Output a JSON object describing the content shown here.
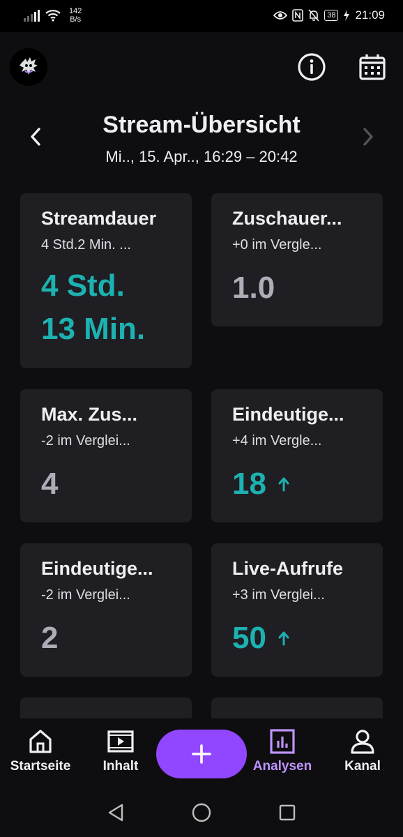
{
  "status_bar": {
    "net_speed_value": "142",
    "net_speed_unit": "B/s",
    "battery": "38",
    "time": "21:09"
  },
  "header": {
    "title": "Stream-Übersicht",
    "subtitle": "Mi.., 15. Apr.., 16:29 – 20:42"
  },
  "cards": [
    {
      "title": "Streamdauer",
      "sub": "4 Std.2 Min. ...",
      "value_line1": "4 Std.",
      "value_line2": "13 Min.",
      "color": "#1db2b2"
    },
    {
      "title": "Zuschauer...",
      "sub": "+0 im Vergle...",
      "value": "1.0",
      "color": "#adadb8"
    },
    {
      "title": "Max. Zus...",
      "sub": "-2 im Verglei...",
      "value": "4",
      "color": "#adadb8"
    },
    {
      "title": "Eindeutige...",
      "sub": "+4 im Vergle...",
      "value": "18",
      "color": "#1db2b2",
      "trend": "up"
    },
    {
      "title": "Eindeutige...",
      "sub": "-2 im Verglei...",
      "value": "2",
      "color": "#adadb8"
    },
    {
      "title": "Live-Aufrufe",
      "sub": "+3 im Verglei...",
      "value": "50",
      "color": "#1db2b2",
      "trend": "up"
    }
  ],
  "bottom_nav": {
    "items": [
      {
        "label": "Startseite",
        "icon": "home-icon"
      },
      {
        "label": "Inhalt",
        "icon": "video-icon"
      },
      {
        "label": "Analysen",
        "icon": "analytics-icon",
        "active": true
      },
      {
        "label": "Kanal",
        "icon": "user-icon"
      }
    ],
    "fab_icon": "plus-icon"
  },
  "colors": {
    "background": "#0e0e10",
    "card": "#1f1f23",
    "accent_teal": "#1db2b2",
    "accent_purple": "#9147ff",
    "active_nav": "#bf94ff"
  }
}
